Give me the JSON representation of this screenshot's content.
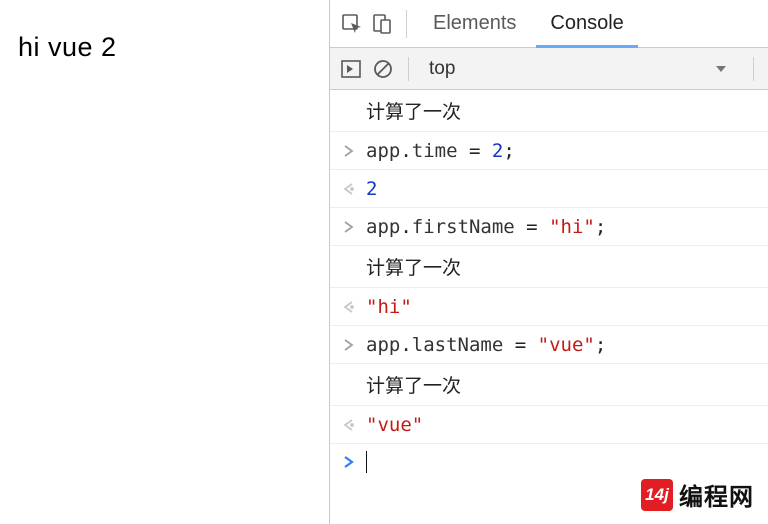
{
  "page": {
    "content": "hi vue 2"
  },
  "devtools": {
    "tabs": {
      "elements": "Elements",
      "console": "Console"
    },
    "toolbar": {
      "context": "top"
    },
    "console_rows": [
      {
        "kind": "log",
        "text": "计算了一次"
      },
      {
        "kind": "input",
        "tokens": [
          [
            "prop",
            "app"
          ],
          [
            "punc",
            "."
          ],
          [
            "prop",
            "time"
          ],
          [
            "punc",
            " = "
          ],
          [
            "num",
            "2"
          ],
          [
            "punc",
            ";"
          ]
        ]
      },
      {
        "kind": "output",
        "tokens": [
          [
            "num",
            "2"
          ]
        ]
      },
      {
        "kind": "input",
        "tokens": [
          [
            "prop",
            "app"
          ],
          [
            "punc",
            "."
          ],
          [
            "prop",
            "firstName"
          ],
          [
            "punc",
            " = "
          ],
          [
            "str",
            "\"hi\""
          ],
          [
            "punc",
            ";"
          ]
        ]
      },
      {
        "kind": "log",
        "text": "计算了一次"
      },
      {
        "kind": "output",
        "tokens": [
          [
            "str",
            "\"hi\""
          ]
        ]
      },
      {
        "kind": "input",
        "tokens": [
          [
            "prop",
            "app"
          ],
          [
            "punc",
            "."
          ],
          [
            "prop",
            "lastName"
          ],
          [
            "punc",
            " = "
          ],
          [
            "str",
            "\"vue\""
          ],
          [
            "punc",
            ";"
          ]
        ]
      },
      {
        "kind": "log",
        "text": "计算了一次"
      },
      {
        "kind": "output",
        "tokens": [
          [
            "str",
            "\"vue\""
          ]
        ]
      }
    ]
  },
  "watermark": {
    "badge": "14j",
    "text": "编程网"
  }
}
